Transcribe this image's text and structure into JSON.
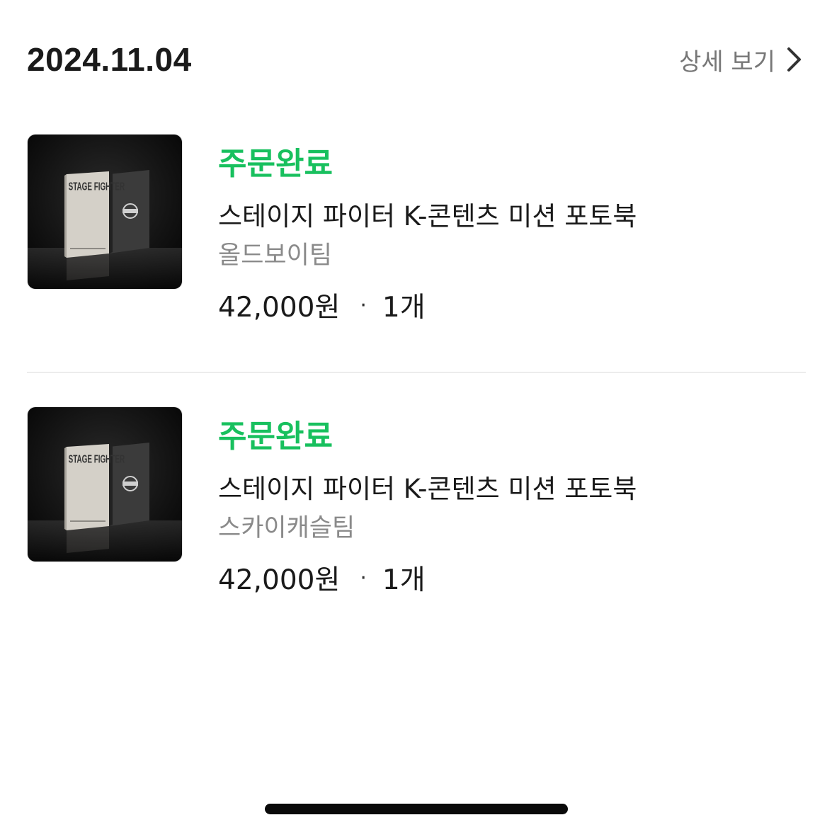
{
  "header": {
    "date": "2024.11.04",
    "detail_label": "상세 보기"
  },
  "orders": [
    {
      "status": "주문완료",
      "title": "스테이지 파이터 K-콘텐츠 미션 포토북",
      "team": "올드보이팀",
      "price": "42,000원",
      "separator": "·",
      "quantity": "1개",
      "image_text": "STAGE FIGHTER"
    },
    {
      "status": "주문완료",
      "title": "스테이지 파이터 K-콘텐츠 미션 포토북",
      "team": "스카이캐슬팀",
      "price": "42,000원",
      "separator": "·",
      "quantity": "1개",
      "image_text": "STAGE FIGHTER"
    }
  ],
  "colors": {
    "status_green": "#18c05e",
    "muted_text": "#8a8a8a",
    "divider": "#ececec"
  }
}
